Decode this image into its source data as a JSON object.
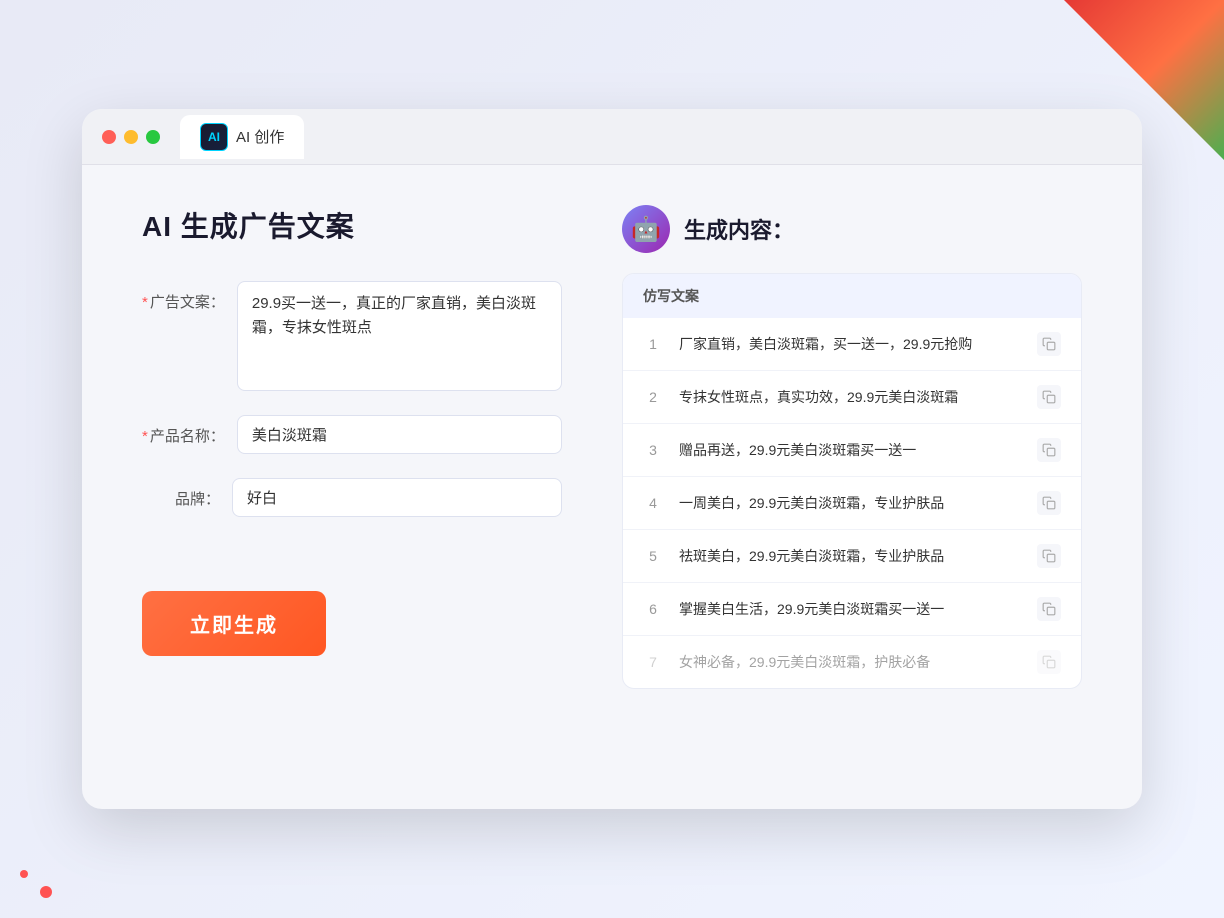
{
  "window": {
    "title_tab": "AI 创作",
    "ai_logo_text": "AI"
  },
  "page": {
    "title": "AI 生成广告文案"
  },
  "form": {
    "ad_copy_label": "广告文案：",
    "ad_copy_required": "*",
    "ad_copy_value": "29.9买一送一，真正的厂家直销，美白淡斑霜，专抹女性斑点",
    "product_name_label": "产品名称：",
    "product_name_required": "*",
    "product_name_value": "美白淡斑霜",
    "brand_label": "品牌：",
    "brand_value": "好白",
    "generate_button": "立即生成"
  },
  "result": {
    "header_label": "生成内容：",
    "table_header": "仿写文案",
    "rows": [
      {
        "num": "1",
        "text": "厂家直销，美白淡斑霜，买一送一，29.9元抢购",
        "faded": false
      },
      {
        "num": "2",
        "text": "专抹女性斑点，真实功效，29.9元美白淡斑霜",
        "faded": false
      },
      {
        "num": "3",
        "text": "赠品再送，29.9元美白淡斑霜买一送一",
        "faded": false
      },
      {
        "num": "4",
        "text": "一周美白，29.9元美白淡斑霜，专业护肤品",
        "faded": false
      },
      {
        "num": "5",
        "text": "祛斑美白，29.9元美白淡斑霜，专业护肤品",
        "faded": false
      },
      {
        "num": "6",
        "text": "掌握美白生活，29.9元美白淡斑霜买一送一",
        "faded": false
      },
      {
        "num": "7",
        "text": "女神必备，29.9元美白淡斑霜，护肤必备",
        "faded": true
      }
    ]
  },
  "colors": {
    "accent_orange": "#ff5722",
    "accent_purple": "#7c83f5",
    "required_red": "#ff5252"
  }
}
